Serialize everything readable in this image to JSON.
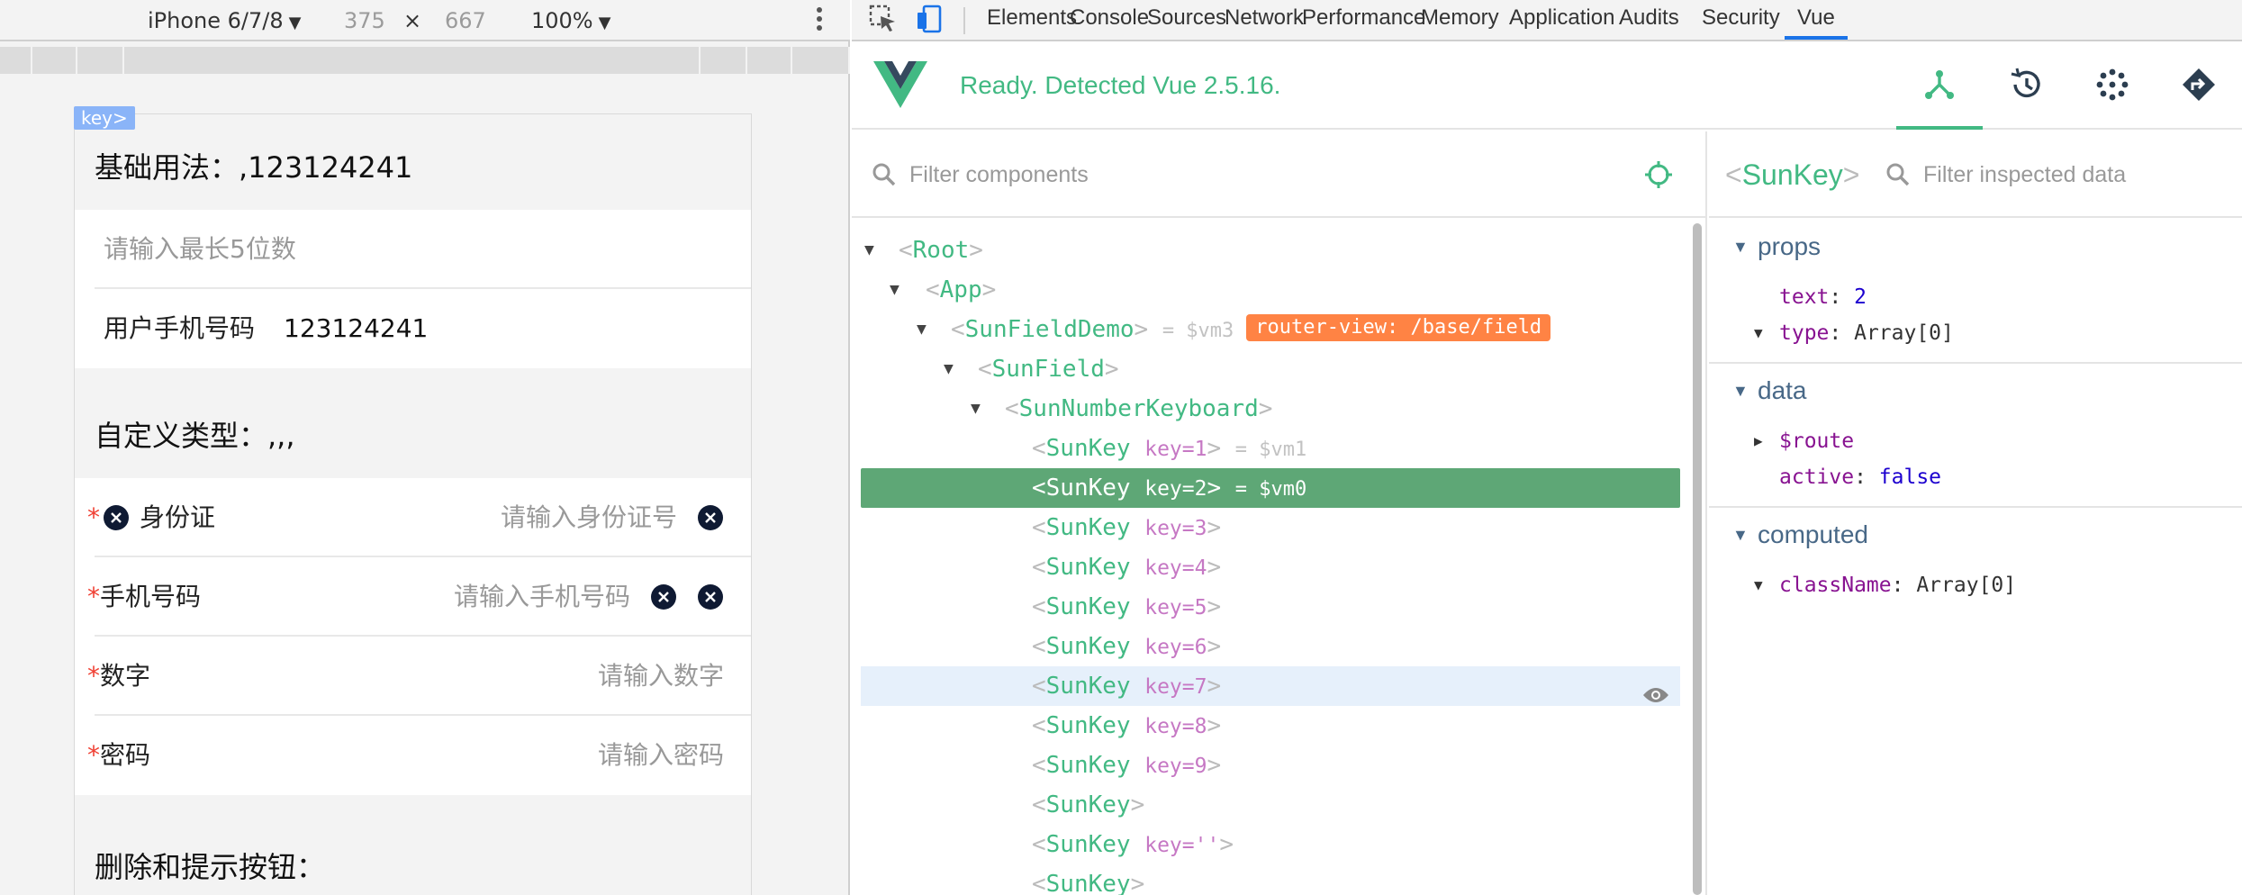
{
  "device_toolbar": {
    "device": "iPhone 6/7/8",
    "width": "375",
    "times": "×",
    "height": "667",
    "zoom": "100%"
  },
  "phone": {
    "key_tag": "key>",
    "basic_title": "基础用法：,123124241",
    "basic_placeholder": "请输入最长5位数",
    "phone_label": "用户手机号码",
    "phone_value": "123124241",
    "custom_title": "自定义类型：,,,",
    "req_mark": "*",
    "rows": [
      {
        "label": "身份证",
        "placeholder": "请输入身份证号"
      },
      {
        "label": "手机号码",
        "placeholder": "请输入手机号码"
      },
      {
        "label": "数字",
        "placeholder": "请输入数字"
      },
      {
        "label": "密码",
        "placeholder": "请输入密码"
      }
    ],
    "delete_title": "删除和提示按钮："
  },
  "devtools_tabs": [
    "Elements",
    "Console",
    "Sources",
    "Network",
    "Performance",
    "Memory",
    "Application",
    "Audits",
    "Security",
    "Vue"
  ],
  "active_tab": "Vue",
  "vue": {
    "status": "Ready. Detected Vue 2.5.16.",
    "filter_components": "Filter components",
    "filter_data": "Filter inspected data",
    "inspected": "SunKey",
    "tree": {
      "root": "Root",
      "app": "App",
      "demo": "SunFieldDemo",
      "demo_ref": "= $vm3",
      "demo_badge": "router-view: /base/field",
      "field": "SunField",
      "keyboard": "SunNumberKeyboard",
      "sunkey": "SunKey",
      "k1_attr": "key",
      "k1_val": "=1",
      "k1_ref": "= $vm1",
      "k2_val": "=2",
      "k2_ref": "= $vm0",
      "k3_val": "=3",
      "k4_val": "=4",
      "k5_val": "=5",
      "k6_val": "=6",
      "k7_val": "=7",
      "k8_val": "=8",
      "k9_val": "=9",
      "k11_val": "=''"
    },
    "sections": {
      "props": "props",
      "data": "data",
      "computed": "computed"
    },
    "props": {
      "text_key": "text",
      "text_val": "2",
      "type_key": "type",
      "type_val": "Array[0]"
    },
    "data": {
      "route_key": "$route",
      "active_key": "active",
      "active_val": "false"
    },
    "computed": {
      "class_key": "className",
      "class_val": "Array[0]"
    },
    "colors": {
      "vue_green": "#42b983",
      "selected_row": "#5ea776",
      "badge": "#ff8344",
      "active_tab_underline": "#1a73e8"
    }
  }
}
